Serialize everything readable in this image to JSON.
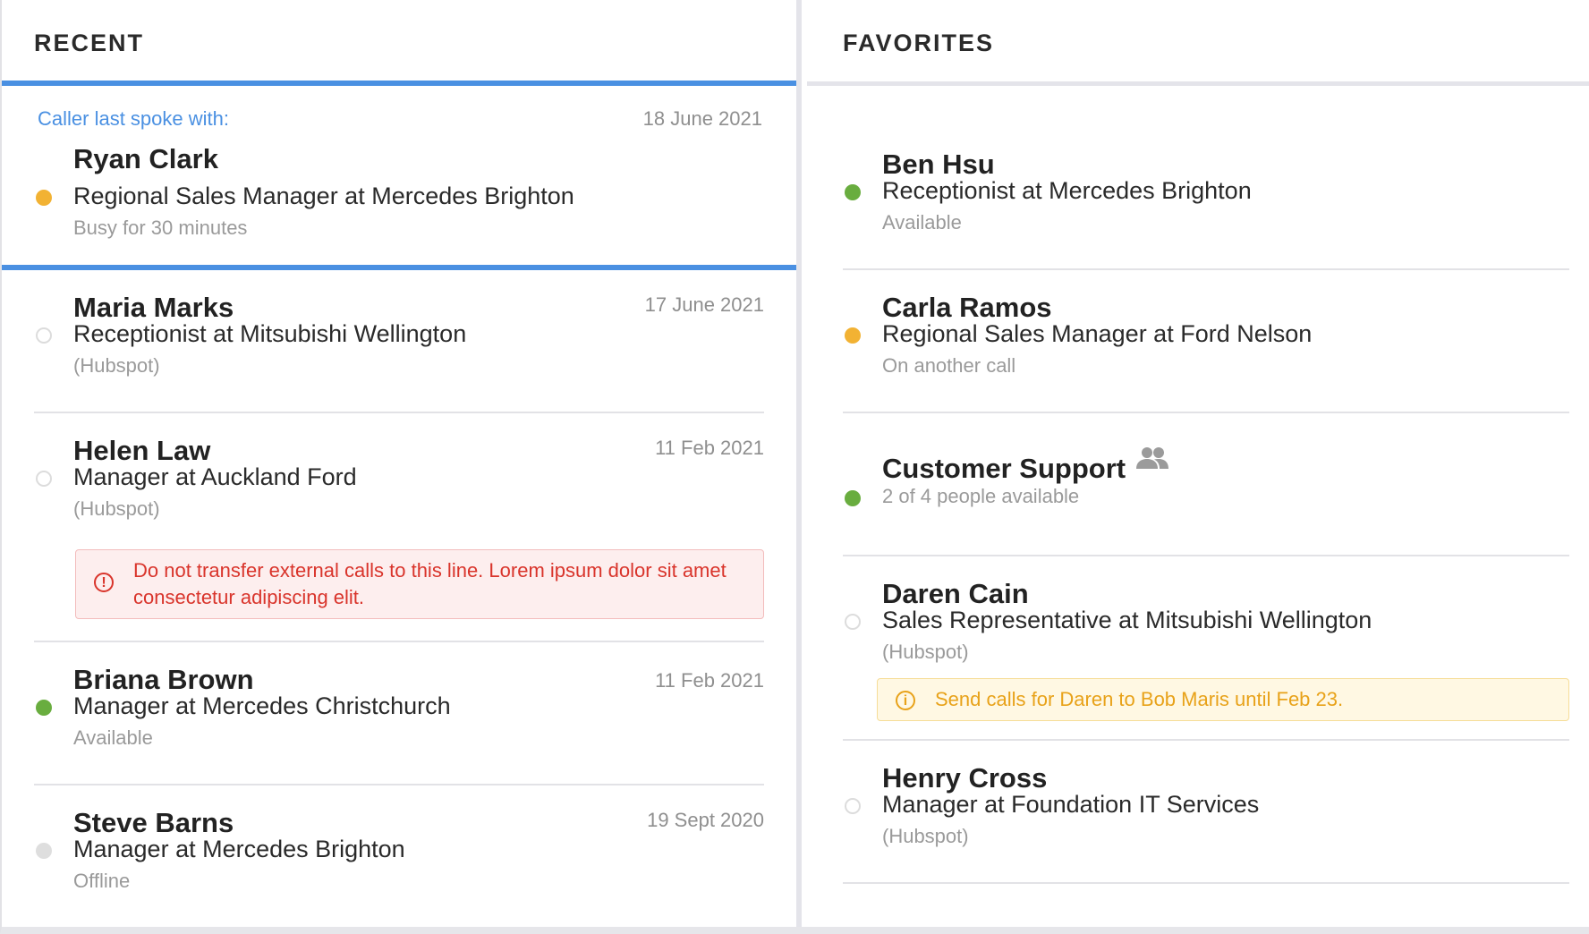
{
  "recent": {
    "title": "RECENT",
    "selected": {
      "spoke_label": "Caller last spoke with:",
      "date": "18 June 2021",
      "name": "Ryan Clark",
      "role": "Regional Sales Manager at Mercedes Brighton",
      "status": "Busy for 30 minutes",
      "presence": "busy"
    },
    "items": [
      {
        "name": "Maria Marks",
        "role": "Receptionist at Mitsubishi Wellington",
        "status": "(Hubspot)",
        "date": "17 June 2021",
        "presence": "none"
      },
      {
        "name": "Helen Law",
        "role": "Manager at Auckland Ford",
        "status": "(Hubspot)",
        "date": "11 Feb 2021",
        "presence": "none",
        "note": "Do not transfer external calls to this line. Lorem ipsum dolor sit amet consectetur adipiscing elit."
      },
      {
        "name": "Briana Brown",
        "role": "Manager at Mercedes Christchurch",
        "status": "Available",
        "date": "11 Feb 2021",
        "presence": "available"
      },
      {
        "name": "Steve Barns",
        "role": "Manager at Mercedes Brighton",
        "status": "Offline",
        "date": "19 Sept 2020",
        "presence": "offline"
      }
    ]
  },
  "favorites": {
    "title": "FAVORITES",
    "items": [
      {
        "name": "Ben Hsu",
        "role": "Receptionist at Mercedes Brighton",
        "status": "Available",
        "presence": "available"
      },
      {
        "name": "Carla Ramos",
        "role": "Regional Sales Manager at Ford Nelson",
        "status": "On another call",
        "presence": "busy"
      },
      {
        "name": "Customer Support",
        "status": "2 of 4 people available",
        "presence": "available",
        "icon": "group-icon"
      },
      {
        "name": "Daren Cain",
        "role": "Sales Representative at Mitsubishi Wellington",
        "status": "(Hubspot)",
        "presence": "none",
        "note": "Send calls for Daren to Bob Maris until Feb 23."
      },
      {
        "name": "Henry Cross",
        "role": "Manager at Foundation IT Services",
        "status": "(Hubspot)",
        "presence": "none"
      }
    ]
  },
  "colors": {
    "accent": "#4a90e2",
    "busy": "#f2b233",
    "available": "#69ad3f",
    "offline": "#dedede",
    "danger": "#d9342b",
    "warning": "#e8a219"
  }
}
